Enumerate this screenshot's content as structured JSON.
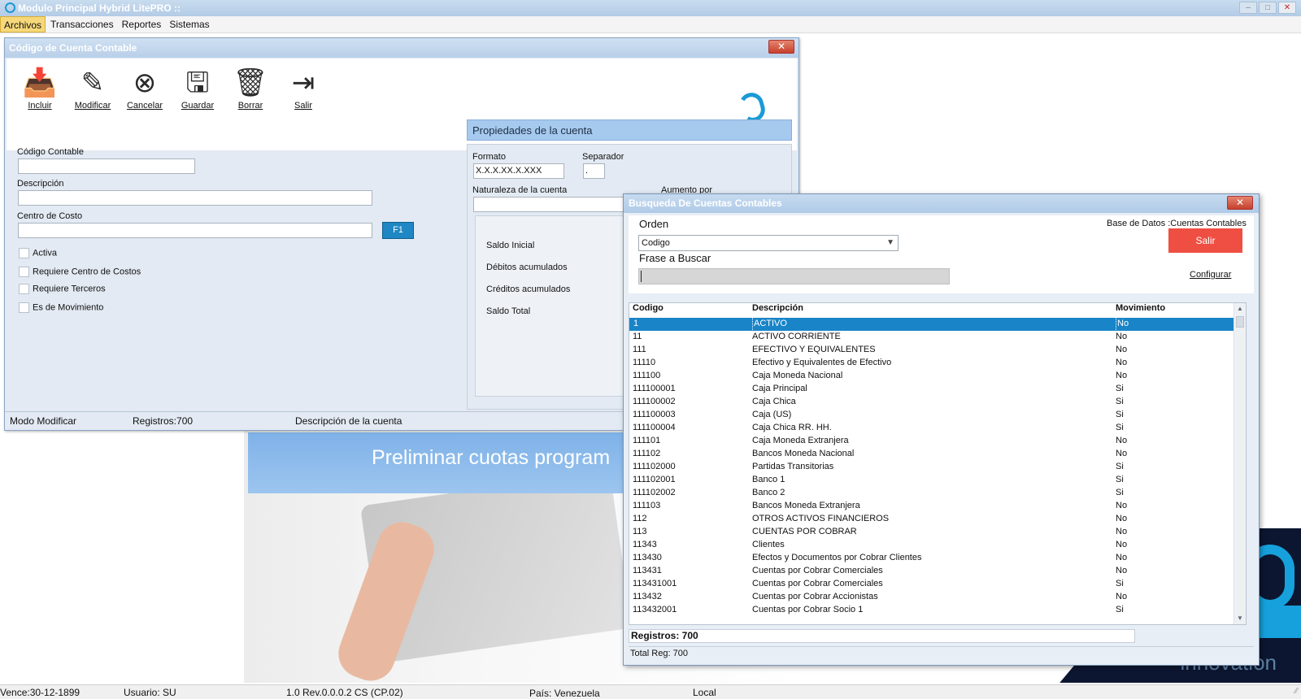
{
  "app": {
    "title": "Modulo Principal Hybrid LitePRO ::",
    "window_controls": {
      "minimize": "–",
      "maximize": "□",
      "close": "✕"
    }
  },
  "menu": [
    "Archivos",
    "Transacciones",
    "Reportes",
    "Sistemas"
  ],
  "background": {
    "banner_text": "Preliminar cuotas program",
    "innovation_text": "innovation"
  },
  "account_window": {
    "title": "Código de Cuenta Contable",
    "close": "✕",
    "toolbar": [
      {
        "label": "Incluir",
        "icon": "inbox-icon"
      },
      {
        "label": "Modificar",
        "icon": "pencil-icon"
      },
      {
        "label": "Cancelar",
        "icon": "cancel-icon"
      },
      {
        "label": "Guardar",
        "icon": "save-icon"
      },
      {
        "label": "Borrar",
        "icon": "trash-icon"
      },
      {
        "label": "Salir",
        "icon": "exit-icon"
      }
    ],
    "fields": {
      "codigo_label": "Código Contable",
      "descripcion_label": "Descripción",
      "centro_label": "Centro de Costo",
      "f1_label": "F1"
    },
    "checkboxes": [
      "Activa",
      "Requiere Centro de Costos",
      "Requiere Terceros",
      "Es de Movimiento"
    ],
    "properties": {
      "header": "Propiedades de la cuenta",
      "formato_label": "Formato",
      "formato_value": "X.X.X.XX.X.XXX",
      "separador_label": "Separador",
      "separador_value": ".",
      "naturaleza_label": "Naturaleza de la cuenta",
      "aumento_label": "Aumento por",
      "saldo_inicial": "Saldo Inicial",
      "debitos": "Débitos acumulados",
      "creditos": "Créditos acumulados",
      "saldo_total": "Saldo Total"
    },
    "status": {
      "mode": "Modo Modificar",
      "records": "Registros:700",
      "description": "Descripción de la cuenta"
    }
  },
  "search_window": {
    "title": "Busqueda De Cuentas Contables",
    "close": "✕",
    "orden_label": "Orden",
    "orden_value": "Codigo",
    "frase_label": "Frase a  Buscar",
    "db_label": "Base de Datos :Cuentas Contables",
    "salir_label": "Salir",
    "configurar_label": "Configurar",
    "columns": [
      "Codigo",
      "Descripción",
      "Movimiento"
    ],
    "rows": [
      {
        "codigo": "1",
        "descripcion": "ACTIVO",
        "movimiento": "No"
      },
      {
        "codigo": "11",
        "descripcion": "ACTIVO CORRIENTE",
        "movimiento": "No"
      },
      {
        "codigo": "111",
        "descripcion": "EFECTIVO Y EQUIVALENTES",
        "movimiento": "No"
      },
      {
        "codigo": "11110",
        "descripcion": "Efectivo y Equivalentes de Efectivo",
        "movimiento": "No"
      },
      {
        "codigo": "111100",
        "descripcion": "Caja Moneda Nacional",
        "movimiento": "No"
      },
      {
        "codigo": "111100001",
        "descripcion": "Caja Principal",
        "movimiento": "Si"
      },
      {
        "codigo": "111100002",
        "descripcion": "Caja Chica",
        "movimiento": "Si"
      },
      {
        "codigo": "111100003",
        "descripcion": "Caja (US)",
        "movimiento": "Si"
      },
      {
        "codigo": "111100004",
        "descripcion": "Caja Chica RR. HH.",
        "movimiento": "Si"
      },
      {
        "codigo": "111101",
        "descripcion": "Caja Moneda Extranjera",
        "movimiento": "No"
      },
      {
        "codigo": "111102",
        "descripcion": "Bancos Moneda Nacional",
        "movimiento": "No"
      },
      {
        "codigo": "111102000",
        "descripcion": "Partidas Transitorias",
        "movimiento": "Si"
      },
      {
        "codigo": "111102001",
        "descripcion": "Banco 1",
        "movimiento": "Si"
      },
      {
        "codigo": "111102002",
        "descripcion": "Banco 2",
        "movimiento": "Si"
      },
      {
        "codigo": "111103",
        "descripcion": "Bancos Moneda Extranjera",
        "movimiento": "No"
      },
      {
        "codigo": "112",
        "descripcion": "OTROS ACTIVOS FINANCIEROS",
        "movimiento": "No"
      },
      {
        "codigo": "113",
        "descripcion": "CUENTAS POR COBRAR",
        "movimiento": "No"
      },
      {
        "codigo": "11343",
        "descripcion": "Clientes",
        "movimiento": "No"
      },
      {
        "codigo": "113430",
        "descripcion": "Efectos y Documentos por Cobrar Clientes",
        "movimiento": "No"
      },
      {
        "codigo": "113431",
        "descripcion": "Cuentas por Cobrar Comerciales",
        "movimiento": "No"
      },
      {
        "codigo": "113431001",
        "descripcion": "Cuentas por Cobrar Comerciales",
        "movimiento": "Si"
      },
      {
        "codigo": "113432",
        "descripcion": "Cuentas por Cobrar Accionistas",
        "movimiento": "No"
      },
      {
        "codigo": "113432001",
        "descripcion": "Cuentas por Cobrar Socio 1",
        "movimiento": "Si"
      }
    ],
    "registros": "Registros: 700",
    "total_reg": "Total Reg: 700"
  },
  "statusbar": {
    "vence": "Vence:30-12-1899",
    "usuario": "Usuario: SU",
    "version": "1.0 Rev.0.0.0.2 CS (CP.02)",
    "pais": "País: Venezuela",
    "local": "Local"
  },
  "colors": {
    "accent": "#1985c8",
    "salir": "#ef4f42",
    "props_header": "#a6c9ee"
  }
}
